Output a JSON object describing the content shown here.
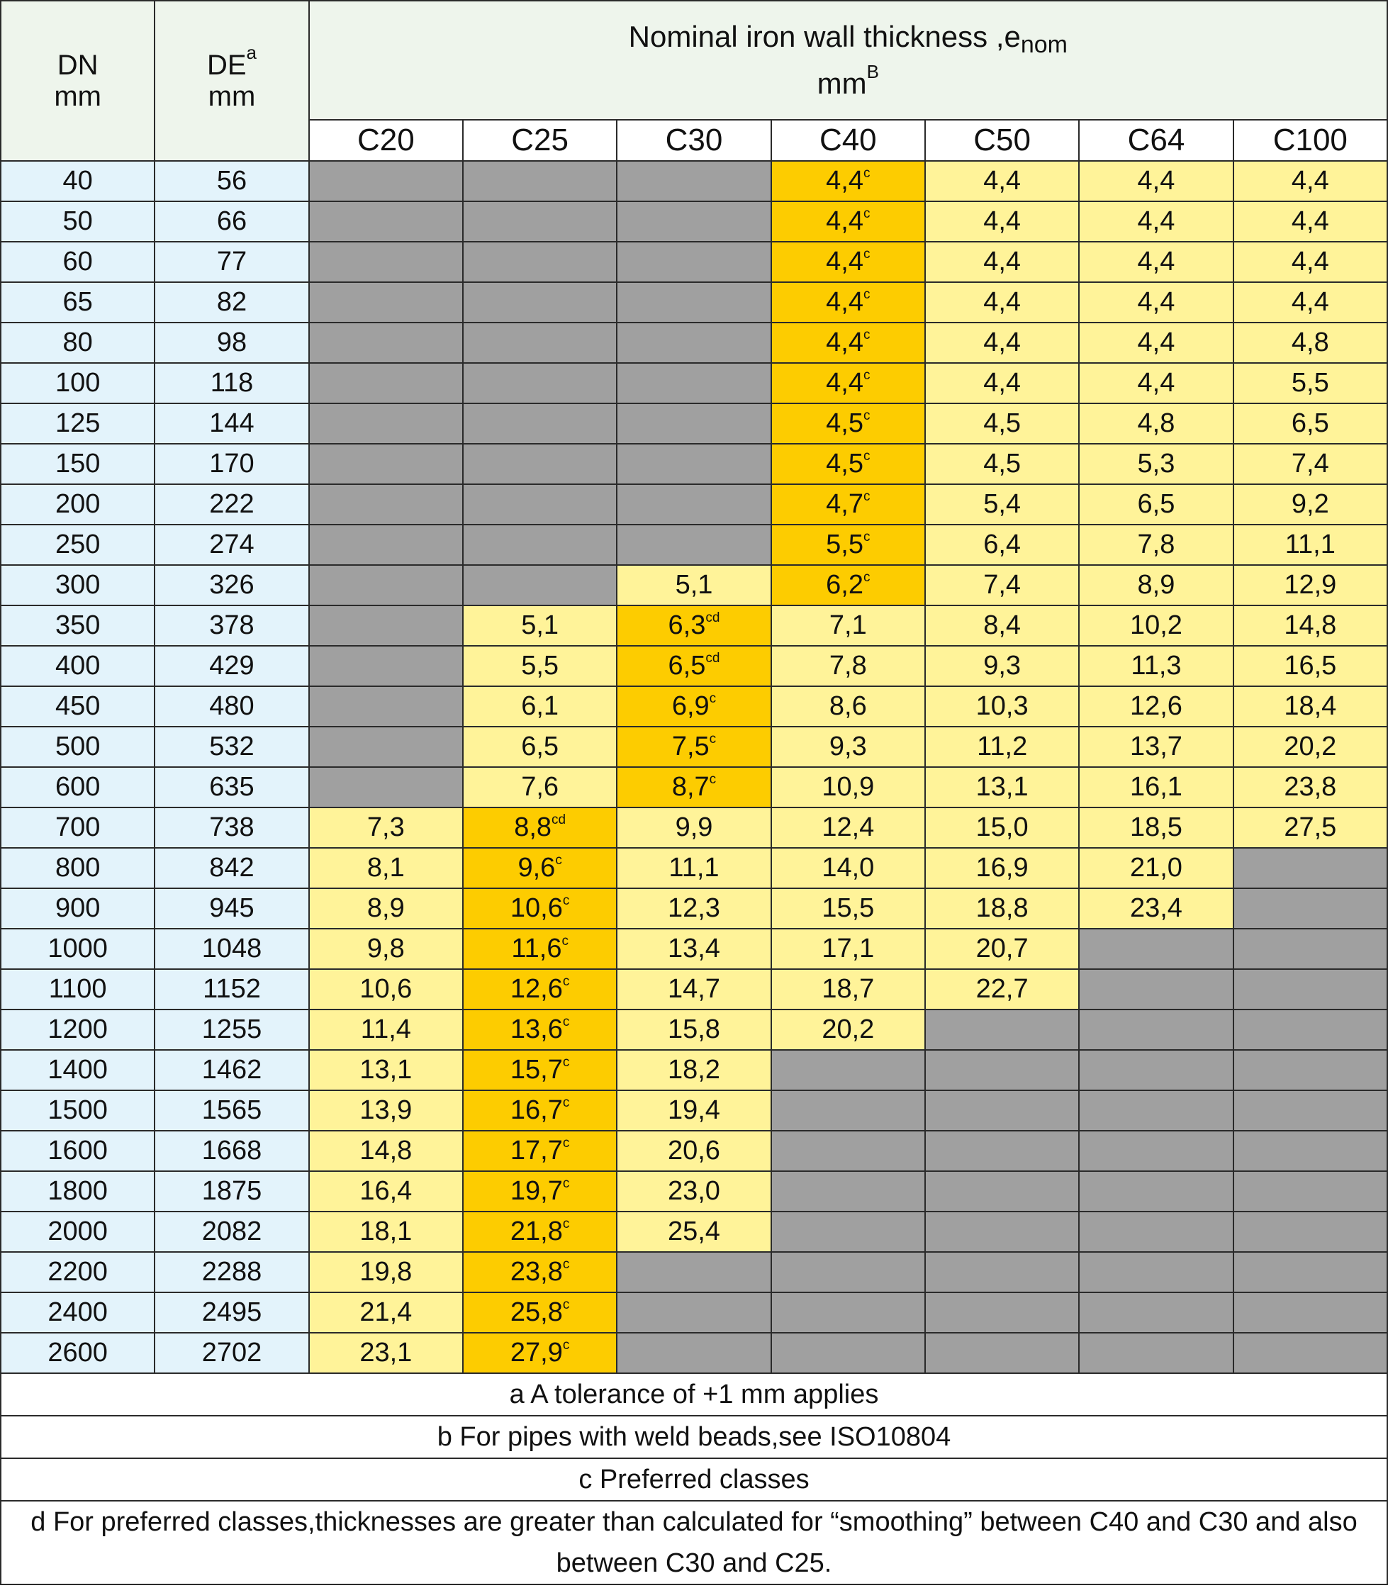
{
  "header": {
    "dn_label": "DN",
    "dn_unit": "mm",
    "de_label": "DE",
    "de_sup": "a",
    "de_unit": "mm",
    "title_main": "Nominal iron wall thickness ,e",
    "title_sub": "nom",
    "title_unit": "mm",
    "title_unit_sup": "B"
  },
  "classes": [
    "C20",
    "C25",
    "C30",
    "C40",
    "C50",
    "C64",
    "C100"
  ],
  "rows": [
    {
      "dn": "40",
      "de": "56",
      "cells": [
        null,
        null,
        null,
        {
          "v": "4,4",
          "s": "c"
        },
        {
          "v": "4,4"
        },
        {
          "v": "4,4"
        },
        {
          "v": "4,4"
        }
      ]
    },
    {
      "dn": "50",
      "de": "66",
      "cells": [
        null,
        null,
        null,
        {
          "v": "4,4",
          "s": "c"
        },
        {
          "v": "4,4"
        },
        {
          "v": "4,4"
        },
        {
          "v": "4,4"
        }
      ]
    },
    {
      "dn": "60",
      "de": "77",
      "cells": [
        null,
        null,
        null,
        {
          "v": "4,4",
          "s": "c"
        },
        {
          "v": "4,4"
        },
        {
          "v": "4,4"
        },
        {
          "v": "4,4"
        }
      ]
    },
    {
      "dn": "65",
      "de": "82",
      "cells": [
        null,
        null,
        null,
        {
          "v": "4,4",
          "s": "c"
        },
        {
          "v": "4,4"
        },
        {
          "v": "4,4"
        },
        {
          "v": "4,4"
        }
      ]
    },
    {
      "dn": "80",
      "de": "98",
      "cells": [
        null,
        null,
        null,
        {
          "v": "4,4",
          "s": "c"
        },
        {
          "v": "4,4"
        },
        {
          "v": "4,4"
        },
        {
          "v": "4,8"
        }
      ]
    },
    {
      "dn": "100",
      "de": "118",
      "cells": [
        null,
        null,
        null,
        {
          "v": "4,4",
          "s": "c"
        },
        {
          "v": "4,4"
        },
        {
          "v": "4,4"
        },
        {
          "v": "5,5"
        }
      ]
    },
    {
      "dn": "125",
      "de": "144",
      "cells": [
        null,
        null,
        null,
        {
          "v": "4,5",
          "s": "c"
        },
        {
          "v": "4,5"
        },
        {
          "v": "4,8"
        },
        {
          "v": "6,5"
        }
      ]
    },
    {
      "dn": "150",
      "de": "170",
      "cells": [
        null,
        null,
        null,
        {
          "v": "4,5",
          "s": "c"
        },
        {
          "v": "4,5"
        },
        {
          "v": "5,3"
        },
        {
          "v": "7,4"
        }
      ]
    },
    {
      "dn": "200",
      "de": "222",
      "cells": [
        null,
        null,
        null,
        {
          "v": "4,7",
          "s": "c"
        },
        {
          "v": "5,4"
        },
        {
          "v": "6,5"
        },
        {
          "v": "9,2"
        }
      ]
    },
    {
      "dn": "250",
      "de": "274",
      "cells": [
        null,
        null,
        null,
        {
          "v": "5,5",
          "s": "c"
        },
        {
          "v": "6,4"
        },
        {
          "v": "7,8"
        },
        {
          "v": "11,1"
        }
      ]
    },
    {
      "dn": "300",
      "de": "326",
      "cells": [
        null,
        null,
        {
          "v": "5,1"
        },
        {
          "v": "6,2",
          "s": "c"
        },
        {
          "v": "7,4"
        },
        {
          "v": "8,9"
        },
        {
          "v": "12,9"
        }
      ]
    },
    {
      "dn": "350",
      "de": "378",
      "cells": [
        null,
        {
          "v": "5,1"
        },
        {
          "v": "6,3",
          "s": "cd"
        },
        {
          "v": "7,1"
        },
        {
          "v": "8,4"
        },
        {
          "v": "10,2"
        },
        {
          "v": "14,8"
        }
      ]
    },
    {
      "dn": "400",
      "de": "429",
      "cells": [
        null,
        {
          "v": "5,5"
        },
        {
          "v": "6,5",
          "s": "cd"
        },
        {
          "v": "7,8"
        },
        {
          "v": "9,3"
        },
        {
          "v": "11,3"
        },
        {
          "v": "16,5"
        }
      ]
    },
    {
      "dn": "450",
      "de": "480",
      "cells": [
        null,
        {
          "v": "6,1"
        },
        {
          "v": "6,9",
          "s": "c"
        },
        {
          "v": "8,6"
        },
        {
          "v": "10,3"
        },
        {
          "v": "12,6"
        },
        {
          "v": "18,4"
        }
      ]
    },
    {
      "dn": "500",
      "de": "532",
      "cells": [
        null,
        {
          "v": "6,5"
        },
        {
          "v": "7,5",
          "s": "c"
        },
        {
          "v": "9,3"
        },
        {
          "v": "11,2"
        },
        {
          "v": "13,7"
        },
        {
          "v": "20,2"
        }
      ]
    },
    {
      "dn": "600",
      "de": "635",
      "cells": [
        null,
        {
          "v": "7,6"
        },
        {
          "v": "8,7",
          "s": "c"
        },
        {
          "v": "10,9"
        },
        {
          "v": "13,1"
        },
        {
          "v": "16,1"
        },
        {
          "v": "23,8"
        }
      ]
    },
    {
      "dn": "700",
      "de": "738",
      "cells": [
        {
          "v": "7,3"
        },
        {
          "v": "8,8",
          "s": "cd"
        },
        {
          "v": "9,9"
        },
        {
          "v": "12,4"
        },
        {
          "v": "15,0"
        },
        {
          "v": "18,5"
        },
        {
          "v": "27,5"
        }
      ]
    },
    {
      "dn": "800",
      "de": "842",
      "cells": [
        {
          "v": "8,1"
        },
        {
          "v": "9,6",
          "s": "c"
        },
        {
          "v": "11,1"
        },
        {
          "v": "14,0"
        },
        {
          "v": "16,9"
        },
        {
          "v": "21,0"
        },
        null
      ]
    },
    {
      "dn": "900",
      "de": "945",
      "cells": [
        {
          "v": "8,9"
        },
        {
          "v": "10,6",
          "s": "c"
        },
        {
          "v": "12,3"
        },
        {
          "v": "15,5"
        },
        {
          "v": "18,8"
        },
        {
          "v": "23,4"
        },
        null
      ]
    },
    {
      "dn": "1000",
      "de": "1048",
      "cells": [
        {
          "v": "9,8"
        },
        {
          "v": "11,6",
          "s": "c"
        },
        {
          "v": "13,4"
        },
        {
          "v": "17,1"
        },
        {
          "v": "20,7"
        },
        null,
        null
      ]
    },
    {
      "dn": "1100",
      "de": "1152",
      "cells": [
        {
          "v": "10,6"
        },
        {
          "v": "12,6",
          "s": "c"
        },
        {
          "v": "14,7"
        },
        {
          "v": "18,7"
        },
        {
          "v": "22,7"
        },
        null,
        null
      ]
    },
    {
      "dn": "1200",
      "de": "1255",
      "cells": [
        {
          "v": "11,4"
        },
        {
          "v": "13,6",
          "s": "c"
        },
        {
          "v": "15,8"
        },
        {
          "v": "20,2"
        },
        null,
        null,
        null
      ]
    },
    {
      "dn": "1400",
      "de": "1462",
      "cells": [
        {
          "v": "13,1"
        },
        {
          "v": "15,7",
          "s": "c"
        },
        {
          "v": "18,2"
        },
        null,
        null,
        null,
        null
      ]
    },
    {
      "dn": "1500",
      "de": "1565",
      "cells": [
        {
          "v": "13,9"
        },
        {
          "v": "16,7",
          "s": "c"
        },
        {
          "v": "19,4"
        },
        null,
        null,
        null,
        null
      ]
    },
    {
      "dn": "1600",
      "de": "1668",
      "cells": [
        {
          "v": "14,8"
        },
        {
          "v": "17,7",
          "s": "c"
        },
        {
          "v": "20,6"
        },
        null,
        null,
        null,
        null
      ]
    },
    {
      "dn": "1800",
      "de": "1875",
      "cells": [
        {
          "v": "16,4"
        },
        {
          "v": "19,7",
          "s": "c"
        },
        {
          "v": "23,0"
        },
        null,
        null,
        null,
        null
      ]
    },
    {
      "dn": "2000",
      "de": "2082",
      "cells": [
        {
          "v": "18,1"
        },
        {
          "v": "21,8",
          "s": "c"
        },
        {
          "v": "25,4"
        },
        null,
        null,
        null,
        null
      ]
    },
    {
      "dn": "2200",
      "de": "2288",
      "cells": [
        {
          "v": "19,8"
        },
        {
          "v": "23,8",
          "s": "c"
        },
        null,
        null,
        null,
        null,
        null
      ]
    },
    {
      "dn": "2400",
      "de": "2495",
      "cells": [
        {
          "v": "21,4"
        },
        {
          "v": "25,8",
          "s": "c"
        },
        null,
        null,
        null,
        null,
        null
      ]
    },
    {
      "dn": "2600",
      "de": "2702",
      "cells": [
        {
          "v": "23,1"
        },
        {
          "v": "27,9",
          "s": "c"
        },
        null,
        null,
        null,
        null,
        null
      ]
    }
  ],
  "notes": [
    "a A tolerance of +1 mm applies",
    "b For pipes with weld beads,see ISO10804",
    "c Preferred classes",
    "d For preferred classes,thicknesses are greater than calculated for “smoothing” between C40 and C30 and also between C30 and C25."
  ],
  "colors": {
    "unavailable": "#a0a0a0",
    "available": "#fff399",
    "preferred": "#fdcc00",
    "dn_de_background": "#e3f3fb",
    "header_background": "#eef5ec"
  }
}
